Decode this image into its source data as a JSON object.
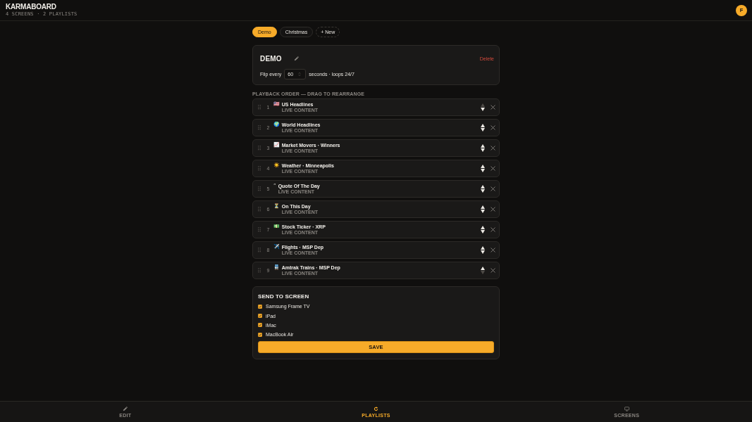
{
  "header": {
    "title": "KARMABOARD",
    "subtitle": "4 SCREENS · 2 PLAYLISTS",
    "avatar": "F"
  },
  "playlist_tabs": [
    {
      "label": "Demo",
      "selected": true
    },
    {
      "label": "Christmas",
      "selected": false
    }
  ],
  "new_playlist": "+ New",
  "playlist": {
    "name": "DEMO",
    "delete": "Delete",
    "flip_label": "Flip every",
    "flip_seconds": "60",
    "flip_suffix": "seconds · loops 24/7"
  },
  "order_label": "PLAYBACK ORDER — DRAG TO REARRANGE",
  "items": [
    {
      "number": "1",
      "emoji": "🇺🇸",
      "title": "US Headlines",
      "type": "LIVE CONTENT",
      "up_disabled": true,
      "down_disabled": false
    },
    {
      "number": "2",
      "emoji": "🌍",
      "title": "World Headlines",
      "type": "LIVE CONTENT",
      "up_disabled": false,
      "down_disabled": false
    },
    {
      "number": "3",
      "emoji": "📈",
      "title": "Market Movers · Winners",
      "type": "LIVE CONTENT",
      "up_disabled": false,
      "down_disabled": false
    },
    {
      "number": "4",
      "emoji": "☀️",
      "title": "Weather · Minneapolis",
      "type": "LIVE CONTENT",
      "up_disabled": false,
      "down_disabled": false
    },
    {
      "number": "5",
      "emoji": "“",
      "title": "Quote Of The Day",
      "type": "LIVE CONTENT",
      "up_disabled": false,
      "down_disabled": false
    },
    {
      "number": "6",
      "emoji": "⏳",
      "title": "On This Day",
      "type": "LIVE CONTENT",
      "up_disabled": false,
      "down_disabled": false
    },
    {
      "number": "7",
      "emoji": "💵",
      "title": "Stock Ticker · XRP",
      "type": "LIVE CONTENT",
      "up_disabled": false,
      "down_disabled": false
    },
    {
      "number": "8",
      "emoji": "✈️",
      "title": "Flights · MSP Dep",
      "type": "LIVE CONTENT",
      "up_disabled": false,
      "down_disabled": false
    },
    {
      "number": "9",
      "emoji": "🚆",
      "title": "Amtrak Trains · MSP Dep",
      "type": "LIVE CONTENT",
      "up_disabled": false,
      "down_disabled": true
    }
  ],
  "send": {
    "title": "SEND TO SCREEN",
    "screens": [
      {
        "name": "Samsung Frame TV",
        "checked": true
      },
      {
        "name": "iPad",
        "checked": true
      },
      {
        "name": "iMac",
        "checked": true
      },
      {
        "name": "MacBook Air",
        "checked": true
      }
    ],
    "save": "SAVE"
  },
  "nav": [
    {
      "kind": "edit",
      "label": "EDIT",
      "selected": false
    },
    {
      "kind": "playlists",
      "label": "PLAYLISTS",
      "selected": true
    },
    {
      "kind": "screens",
      "label": "SCREENS",
      "selected": false
    }
  ]
}
